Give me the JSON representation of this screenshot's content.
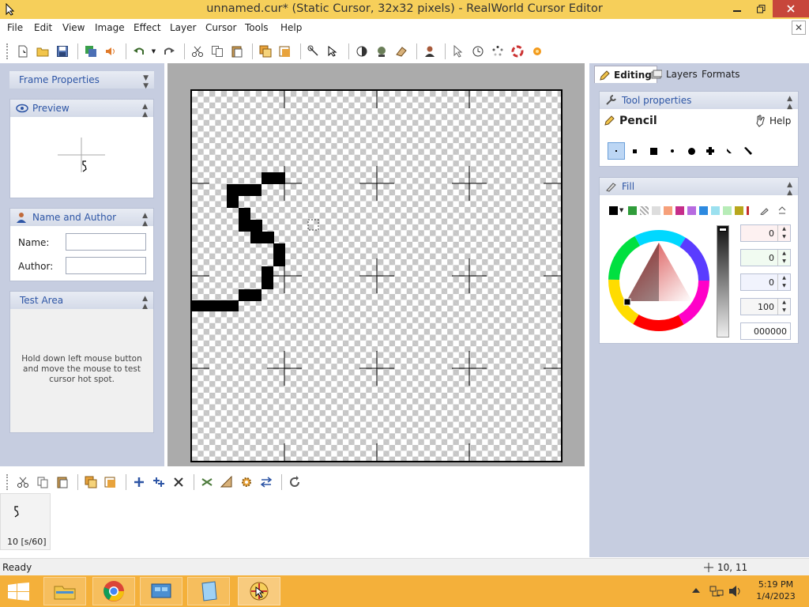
{
  "window": {
    "title": "unnamed.cur* (Static Cursor, 32x32 pixels) - RealWorld Cursor Editor"
  },
  "menu": [
    "File",
    "Edit",
    "View",
    "Image",
    "Effect",
    "Layer",
    "Cursor",
    "Tools",
    "Help"
  ],
  "left_panel": {
    "frame_properties": "Frame Properties",
    "preview": "Preview",
    "name_author": "Name and Author",
    "name_label": "Name:",
    "author_label": "Author:",
    "name_value": "",
    "author_value": "",
    "test_area": "Test Area",
    "test_hint": "Hold down left mouse button and move the mouse to test cursor hot spot."
  },
  "right_panel": {
    "tabs": [
      "Editing",
      "Layers",
      "Formats"
    ],
    "tool_properties": "Tool properties",
    "tool_name": "Pencil",
    "help": "Help",
    "fill": "Fill",
    "spin_values": [
      "0",
      "0",
      "0",
      "100",
      "000000"
    ]
  },
  "frames": {
    "frame_label": "10 [s/60]"
  },
  "status": {
    "text": "Ready",
    "coords": "10, 11"
  },
  "taskbar": {
    "time": "5:19 PM",
    "date": "1/4/2023"
  }
}
